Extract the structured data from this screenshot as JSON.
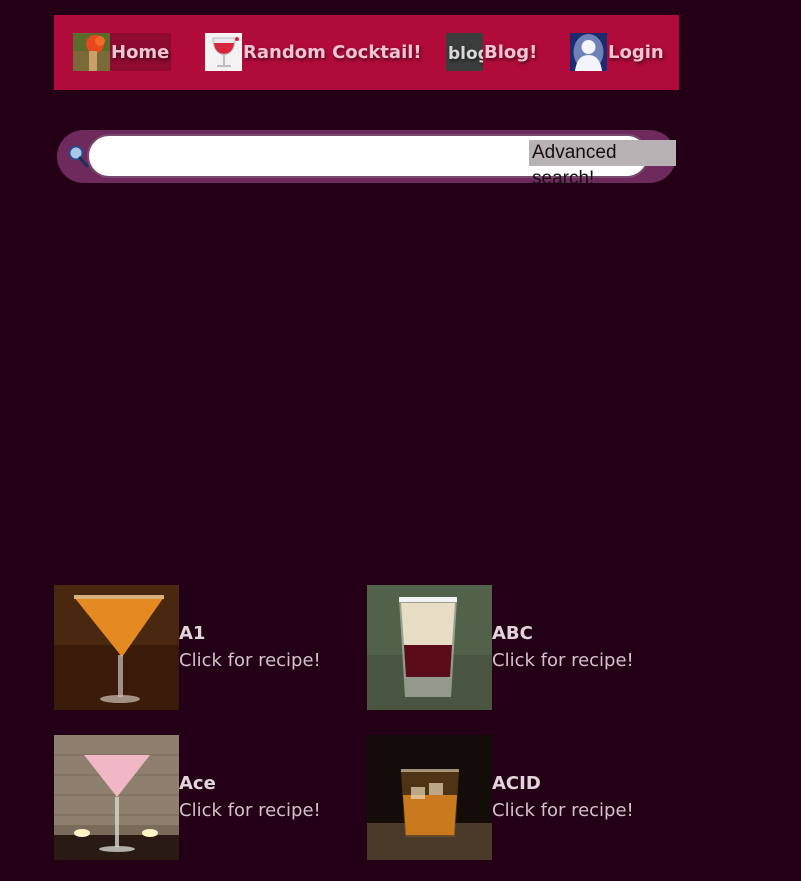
{
  "nav": {
    "items": [
      {
        "label": "Home",
        "icon": "flower-photo-icon"
      },
      {
        "label": "Random Cocktail!",
        "icon": "wine-glass-icon"
      },
      {
        "label": "Blog!",
        "icon": "blog-chalkboard-icon"
      },
      {
        "label": "Login",
        "icon": "user-avatar-icon"
      }
    ]
  },
  "search": {
    "value": "",
    "advanced_label": "Advanced search!"
  },
  "cocktails": [
    {
      "name": "A1",
      "cta": "Click for recipe!"
    },
    {
      "name": "ABC",
      "cta": "Click for recipe!"
    },
    {
      "name": "Ace",
      "cta": "Click for recipe!"
    },
    {
      "name": "ACID",
      "cta": "Click for recipe!"
    }
  ],
  "colors": {
    "background": "#230015",
    "nav_bar": "#b00b3a",
    "search_wrap": "#6e2a5c"
  }
}
